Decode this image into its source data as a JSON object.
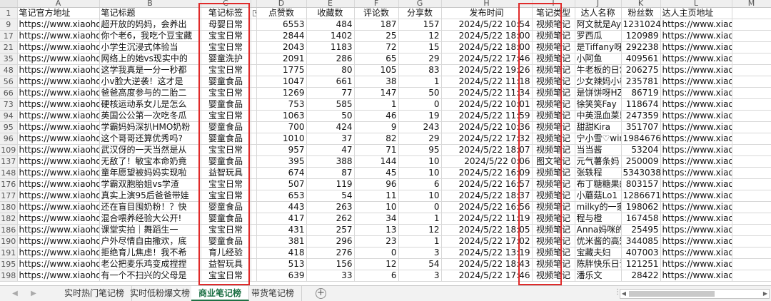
{
  "columns": [
    "A",
    "B",
    "C",
    "D",
    "E",
    "F",
    "G",
    "H",
    "I",
    "J",
    "K",
    "L",
    "M"
  ],
  "headers": [
    "笔记官方地址",
    "笔记标题",
    "笔记标签",
    "点赞数",
    "收藏数",
    "评论数",
    "分享数",
    "发布时间",
    "笔记类型",
    "达人名称",
    "粉丝数",
    "达人主页地址",
    ""
  ],
  "rows": [
    {
      "n": "9",
      "a": "https://www.xiaohong",
      "b": "超开放的妈妈，会养出",
      "c": "母婴日常",
      "d": "6553",
      "e": "484",
      "f": "187",
      "g": "157",
      "h": "2024/5/22 10:54",
      "i": "视频笔记",
      "j": "阿文就是Aya",
      "k": "1231024",
      "l": "https://www.xiaohong"
    },
    {
      "n": "17",
      "a": "https://www.xiaohong",
      "b": "你个老6，我吃个豆宝藏",
      "c": "宝宝日常",
      "d": "2844",
      "e": "1402",
      "f": "25",
      "g": "12",
      "h": "2024/5/22 18:00",
      "i": "视频笔记",
      "j": "罗西瓜",
      "k": "120989",
      "l": "https://www.xiaohong"
    },
    {
      "n": "21",
      "a": "https://www.xiaohong",
      "b": "小学生沉浸式体验当",
      "c": "宝宝日常",
      "d": "2043",
      "e": "1183",
      "f": "72",
      "g": "15",
      "h": "2024/5/22 18:00",
      "i": "视频笔记",
      "j": "是Tiffany呀",
      "k": "292238",
      "l": "https://www.xiaohong"
    },
    {
      "n": "35",
      "a": "https://www.xiaohong",
      "b": "网络上的她vs现实中的",
      "c": "婴童洗护",
      "d": "2091",
      "e": "286",
      "f": "65",
      "g": "29",
      "h": "2024/5/22 17:46",
      "i": "视频笔记",
      "j": "小阿鱼",
      "k": "409561",
      "l": "https://www.xiaohong"
    },
    {
      "n": "48",
      "a": "https://www.xiaohong",
      "b": "这学我真是一分一秒都",
      "c": "宝宝日常",
      "d": "1775",
      "e": "80",
      "f": "105",
      "g": "83",
      "h": "2024/5/22 19:26",
      "i": "视频笔记",
      "j": "牛老板的日常",
      "k": "206275",
      "l": "https://www.xiaohong"
    },
    {
      "n": "56",
      "a": "https://www.xiaohong",
      "b": "小v脸大逆袭！这才是",
      "c": "婴童食品",
      "d": "1047",
      "e": "661",
      "f": "38",
      "g": "1",
      "h": "2024/5/22 11:18",
      "i": "视频笔记",
      "j": "少女辣妈小柠檬",
      "k": "235781",
      "l": "https://www.xiaohong"
    },
    {
      "n": "66",
      "a": "https://www.xiaohong",
      "b": "爸爸高度参与的二胎二",
      "c": "宝宝日常",
      "d": "1269",
      "e": "77",
      "f": "147",
      "g": "50",
      "h": "2024/5/22 11:34",
      "i": "视频笔记",
      "j": "是饼饼呀HZ",
      "k": "86719",
      "l": "https://www.xiaohong"
    },
    {
      "n": "73",
      "a": "https://www.xiaohong",
      "b": "硬核运动系女儿是怎么",
      "c": "婴童食品",
      "d": "753",
      "e": "585",
      "f": "1",
      "g": "0",
      "h": "2024/5/22 10:01",
      "i": "视频笔记",
      "j": "徐笑笑Fay",
      "k": "118674",
      "l": "https://www.xiaohong"
    },
    {
      "n": "94",
      "a": "https://www.xiaohong",
      "b": "英国公公第一次吃冬瓜",
      "c": "宝宝日常",
      "d": "1063",
      "e": "50",
      "f": "46",
      "g": "19",
      "h": "2024/5/22 11:59",
      "i": "视频笔记",
      "j": "中英混血莱恩麦",
      "k": "247359",
      "l": "https://www.xiaohong"
    },
    {
      "n": "95",
      "a": "https://www.xiaohong",
      "b": "学霸妈妈深扒HMO奶粉",
      "c": "婴童食品",
      "d": "700",
      "e": "424",
      "f": "9",
      "g": "243",
      "h": "2024/5/22 10:36",
      "i": "视频笔记",
      "j": "甜甜Kira",
      "k": "351707",
      "l": "https://www.xiaohong"
    },
    {
      "n": "96",
      "a": "https://www.xiaohong",
      "b": "这个哥哥还算优秀吗?",
      "c": "婴童食品",
      "d": "1010",
      "e": "37",
      "f": "82",
      "g": "29",
      "h": "2024/5/22 17:32",
      "i": "视频笔记",
      "j": "宁小雪♡winn",
      "k": "1984676",
      "l": "https://www.xiaohong"
    },
    {
      "n": "109",
      "a": "https://www.xiaohong",
      "b": "武汉伢的一天当然是从",
      "c": "宝宝日常",
      "d": "957",
      "e": "47",
      "f": "71",
      "g": "95",
      "h": "2024/5/22 18:07",
      "i": "视频笔记",
      "j": "当当酱",
      "k": "53204",
      "l": "https://www.xiaohong"
    },
    {
      "n": "137",
      "a": "https://www.xiaohong",
      "b": "无敌了！敏宝本命奶竟",
      "c": "婴童食品",
      "d": "395",
      "e": "388",
      "f": "144",
      "g": "10",
      "h": "2024/5/22 0:06",
      "i": "图文笔记",
      "j": "元气薯条妈",
      "k": "250009",
      "l": "https://www.xiaohong"
    },
    {
      "n": "148",
      "a": "https://www.xiaohong",
      "b": "童年愿望被妈妈实现啦",
      "c": "益智玩具",
      "d": "674",
      "e": "87",
      "f": "45",
      "g": "10",
      "h": "2024/5/22 16:09",
      "i": "视频笔记",
      "j": "张轶程",
      "k": "5343038",
      "l": "https://www.xiaohong"
    },
    {
      "n": "176",
      "a": "https://www.xiaohong",
      "b": "学霸双胞胎姐vs学渣",
      "c": "宝宝日常",
      "d": "507",
      "e": "119",
      "f": "96",
      "g": "6",
      "h": "2024/5/22 16:57",
      "i": "视频笔记",
      "j": "布丁糖糖果的n",
      "k": "803157",
      "l": "https://www.xiaohong"
    },
    {
      "n": "177",
      "a": "https://www.xiaohong",
      "b": "真实上演95后爸爸带娃",
      "c": "宝宝日常",
      "d": "653",
      "e": "54",
      "f": "11",
      "g": "10",
      "h": "2024/5/22 18:37",
      "i": "视频笔记",
      "j": "小蘑菇Lo1",
      "k": "1286671",
      "l": "https://www.xiaohong"
    },
    {
      "n": "180",
      "a": "https://www.xiaohong",
      "b": "还在盲目囤奶粉！？快",
      "c": "婴童食品",
      "d": "443",
      "e": "263",
      "f": "10",
      "g": "0",
      "h": "2024/5/22 16:56",
      "i": "视频笔记",
      "j": "milky的一家",
      "k": "198062",
      "l": "https://www.xiaohong"
    },
    {
      "n": "182",
      "a": "https://www.xiaohong",
      "b": "混合喂养经验大公开!",
      "c": "婴童食品",
      "d": "417",
      "e": "262",
      "f": "34",
      "g": "1",
      "h": "2024/5/22 11:19",
      "i": "视频笔记",
      "j": "程与橙",
      "k": "167458",
      "l": "https://www.xiaohong"
    },
    {
      "n": "186",
      "a": "https://www.xiaohong",
      "b": "课堂实拍｜舞蹈生一",
      "c": "宝宝日常",
      "d": "431",
      "e": "257",
      "f": "13",
      "g": "12",
      "h": "2024/5/22 18:05",
      "i": "视频笔记",
      "j": "Anna妈咪的小",
      "k": "25495",
      "l": "https://www.xiaohong"
    },
    {
      "n": "190",
      "a": "https://www.xiaohong",
      "b": "户外尽情自由撒欢，底",
      "c": "婴童食品",
      "d": "381",
      "e": "296",
      "f": "23",
      "g": "1",
      "h": "2024/5/22 17:02",
      "i": "视频笔记",
      "j": "优米酱的高知者",
      "k": "344085",
      "l": "https://www.xiaohong"
    },
    {
      "n": "191",
      "a": "https://www.xiaohong",
      "b": "拒绝育儿焦虑！我不希",
      "c": "育儿经验",
      "d": "418",
      "e": "276",
      "f": "0",
      "g": "3",
      "h": "2024/5/22 13:19",
      "i": "视频笔记",
      "j": "宝藏夫妇",
      "k": "407003",
      "l": "https://www.xiaohong"
    },
    {
      "n": "195",
      "a": "https://www.xiaohong",
      "b": "老公把麦乐鸡变成捏捏",
      "c": "益智玩具",
      "d": "513",
      "e": "156",
      "f": "12",
      "g": "54",
      "h": "2024/5/22 18:43",
      "i": "视频笔记",
      "j": "陈胖快乐日记",
      "k": "121251",
      "l": "https://www.xiaohong"
    },
    {
      "n": "198",
      "a": "https://www.xiaohong",
      "b": "有一个不扫兴的父母是",
      "c": "宝宝日常",
      "d": "639",
      "e": "33",
      "f": "6",
      "g": "3",
      "h": "2024/5/22 17:46",
      "i": "视频笔记",
      "j": "潘乐文",
      "k": "28422",
      "l": "https://www.xiaohong"
    }
  ],
  "tabs": [
    "实时热门笔记榜",
    "实时低粉爆文榜",
    "商业笔记榜",
    "带货笔记榜"
  ],
  "active_tab": 2,
  "icons": {
    "filter": "filter-dropdown-icon",
    "add_sheet": "plus-circle-icon",
    "prev": "triangle-left-icon",
    "next": "triangle-right-icon"
  },
  "highlight_color": "#e02a2a",
  "active_tab_color": "#1e7145"
}
